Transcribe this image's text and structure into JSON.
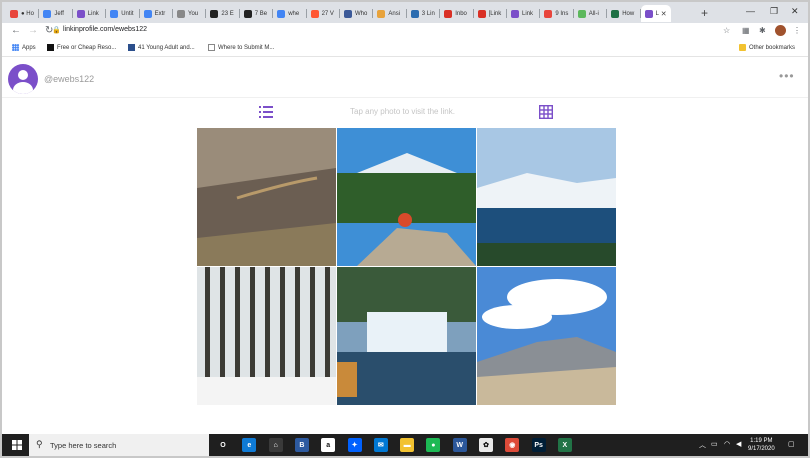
{
  "browser": {
    "tabs": [
      {
        "label": "● Ho",
        "color": "#e8453c"
      },
      {
        "label": "Jeff",
        "color": "#4285f4"
      },
      {
        "label": "Link",
        "color": "#7b4fc9"
      },
      {
        "label": "Untit",
        "color": "#4285f4"
      },
      {
        "label": "Extr",
        "color": "#4285f4"
      },
      {
        "label": "You",
        "color": "#888888"
      },
      {
        "label": "23 E",
        "color": "#222222"
      },
      {
        "label": "7 Be",
        "color": "#222222"
      },
      {
        "label": "whe",
        "color": "#4285f4"
      },
      {
        "label": "27 V",
        "color": "#ff5733"
      },
      {
        "label": "Who",
        "color": "#3b5998"
      },
      {
        "label": "Ansi",
        "color": "#e8a33c"
      },
      {
        "label": "3 Lin",
        "color": "#2b6cb0"
      },
      {
        "label": "Inbo",
        "color": "#d93025"
      },
      {
        "label": "[Link",
        "color": "#d93025"
      },
      {
        "label": "Link",
        "color": "#7b4fc9"
      },
      {
        "label": "9 Ins",
        "color": "#e8453c"
      },
      {
        "label": "All-i",
        "color": "#5cb85c"
      },
      {
        "label": "How",
        "color": "#1e7145"
      },
      {
        "label": "L",
        "color": "#7b4fc9"
      }
    ],
    "new_tab_symbol": "+",
    "window_controls": [
      "—",
      "❐",
      "✕"
    ],
    "url": "linkinprofile.com/ewebs122",
    "bookmarks": [
      {
        "label": "Apps"
      },
      {
        "label": "Free or Cheap Reso..."
      },
      {
        "label": "41 Young Adult and..."
      },
      {
        "label": "Where to Submit M..."
      }
    ],
    "other_bookmarks": "Other bookmarks"
  },
  "page": {
    "username": "@ewebs122",
    "more_symbol": "•••",
    "hint": "Tap any photo to visit the link.",
    "photos": [
      {
        "name": "photo-volcanic-road",
        "sky": "#9a8c7a",
        "ground": "#6b5e52",
        "accent": "#b89a6a"
      },
      {
        "name": "photo-mountain-hiker",
        "sky": "#3e8fd6",
        "ground": "#2f5e2a",
        "accent": "#d94a2b"
      },
      {
        "name": "photo-crater-lake",
        "sky": "#a8c7e4",
        "ground": "#1d4f7c",
        "accent": "#ffffff"
      },
      {
        "name": "photo-snowy-forest",
        "sky": "#dfe4e6",
        "ground": "#3b3a34",
        "accent": "#f4f4f4"
      },
      {
        "name": "photo-waterfall",
        "sky": "#7ea0bd",
        "ground": "#2a4e6c",
        "accent": "#c98a3a"
      },
      {
        "name": "photo-half-dome",
        "sky": "#4a8ad6",
        "ground": "#c9b99b",
        "accent": "#ffffff"
      }
    ]
  },
  "taskbar": {
    "search_placeholder": "Type here to search",
    "time": "1:19 PM",
    "date": "9/17/2020",
    "apps": [
      {
        "label": "O",
        "color": "#1f1f1f"
      },
      {
        "label": "e",
        "color": "#0f7bd6"
      },
      {
        "label": "⌂",
        "color": "#3a3a3a"
      },
      {
        "label": "B",
        "color": "#2d5aa0"
      },
      {
        "label": "a",
        "color": "#ffffff"
      },
      {
        "label": "✦",
        "color": "#0061fe"
      },
      {
        "label": "✉",
        "color": "#0078d4"
      },
      {
        "label": "▬",
        "color": "#f2c230"
      },
      {
        "label": "●",
        "color": "#1db954"
      },
      {
        "label": "W",
        "color": "#2b579a"
      },
      {
        "label": "✿",
        "color": "#e9e9e9"
      },
      {
        "label": "◉",
        "color": "#dd4b39"
      },
      {
        "label": "Ps",
        "color": "#001e36"
      },
      {
        "label": "X",
        "color": "#217346"
      }
    ]
  }
}
